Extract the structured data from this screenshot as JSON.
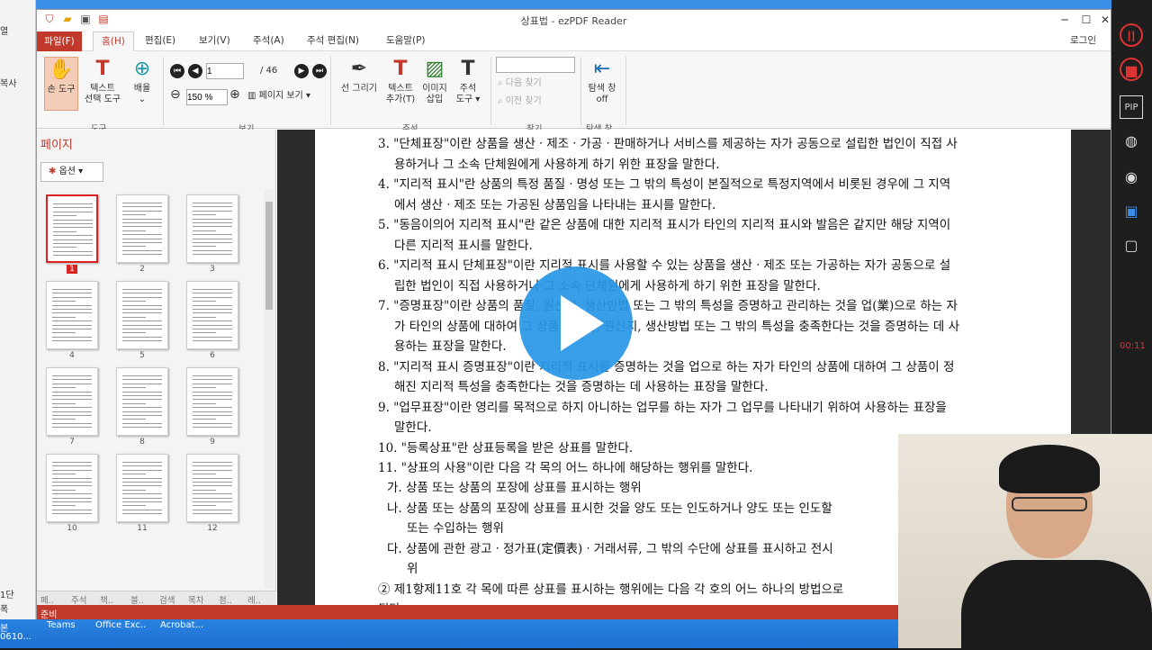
{
  "app": {
    "title": "상표법 - ezPDF Reader",
    "login": "로그인"
  },
  "menu": [
    "파일(F)",
    "홈(H)",
    "편집(E)",
    "보기(V)",
    "주석(A)",
    "주석 편집(N)",
    "도움말(P)"
  ],
  "ribbon": {
    "hand_tool": "손 도구",
    "text_select": [
      "텍스트",
      "선택 도구"
    ],
    "zoom": "배율",
    "group_tools": "도구",
    "page_input": "1",
    "page_total": "/ 46",
    "zoom_value": "150 %",
    "page_view": "페이지 보기",
    "group_view": "보기",
    "line_draw": "선 그리기",
    "text_add": [
      "텍스트",
      "추가(T)"
    ],
    "image_insert": [
      "이미지",
      "삽입"
    ],
    "annot_tool": [
      "주석",
      "도구"
    ],
    "group_annot": "주석",
    "find_next": "다음 찾기",
    "find_prev": "이전 찾기",
    "group_find": "찾기",
    "nav_off": [
      "탐색 창",
      "off"
    ],
    "group_nav": "탐색 창"
  },
  "sidepanel": {
    "title": "페이지",
    "options": "옵션",
    "pages": [
      "1",
      "2",
      "3",
      "4",
      "5",
      "6",
      "7",
      "8",
      "9",
      "10",
      "11",
      "12"
    ],
    "tabs": [
      "페..",
      "주석",
      "책..",
      "블..",
      "검색",
      "목차",
      "첨..",
      "레.."
    ]
  },
  "doc_lines": [
    "3. \"단체표장\"이란 상품을 생산ㆍ제조ㆍ가공ㆍ판매하거나 서비스를 제공하는 자가 공동으로 설립한 법인이 직접 사",
    "용하거나 그 소속 단체원에게 사용하게 하기 위한 표장을 말한다.",
    "4. \"지리적 표시\"란 상품의 특정 품질ㆍ명성 또는 그 밖의 특성이 본질적으로 특정지역에서 비롯된 경우에 그 지역",
    "에서 생산ㆍ제조 또는 가공된 상품임을 나타내는 표시를 말한다.",
    "5. \"동음이의어 지리적 표시\"란 같은 상품에 대한 지리적 표시가 타인의 지리적 표시와 발음은 같지만 해당 지역이",
    "다른 지리적 표시를 말한다.",
    "6. \"지리적 표시 단체표장\"이란 지리적 표시를 사용할 수 있는 상품을 생산ㆍ제조 또는 가공하는 자가 공동으로 설",
    "립한 법인이 직접 사용하거나 그 소속 단체원에게 사용하게 하기 위한 표장을 말한다.",
    "7. \"증명표장\"이란 상품의 품질, 원산지, 생산방법 또는 그 밖의 특성을 증명하고 관리하는 것을 업(業)으로 하는 자",
    "가 타인의 상품에 대하여 그 상품의 품질, 원산지, 생산방법 또는 그 밖의 특성을 충족한다는 것을 증명하는 데 사",
    "용하는 표장을 말한다.",
    "8. \"지리적 표시 증명표장\"이란 지리적 표시를 증명하는 것을 업으로 하는 자가 타인의 상품에 대하여 그 상품이 정",
    "해진 지리적 특성을 충족한다는 것을 증명하는 데 사용하는 표장을 말한다.",
    "9. \"업무표장\"이란 영리를 목적으로 하지 아니하는 업무를 하는 자가 그 업무를 나타내기 위하여 사용하는 표장을",
    "말한다.",
    "10. \"등록상표\"란 상표등록을 받은 상표를 말한다.",
    "11. \"상표의 사용\"이란 다음 각 목의 어느 하나에 해당하는 행위를 말한다.",
    "가. 상품 또는 상품의 포장에 상표를 표시하는 행위",
    "나. 상품 또는 상품의 포장에 상표를 표시한 것을 양도 또는 인도하거나 양도 또는 인도할",
    "또는 수입하는 행위",
    "다. 상품에 관한 광고ㆍ정가표(定價表)ㆍ거래서류, 그 밖의 수단에 상표를 표시하고 전시",
    "위",
    "② 제1항제11호 각 목에 따른 상표를 표시하는 행위에는 다음 각 호의 어느 하나의 방법으로",
    "된다."
  ],
  "status": "준비",
  "taskbar": [
    "Teams",
    "Office Exc..",
    "Acrobat..."
  ],
  "bg_left": [
    "열",
    "복사",
    "1단",
    "폭",
    "본",
    "0610..."
  ],
  "rightbar_time": "00:11"
}
